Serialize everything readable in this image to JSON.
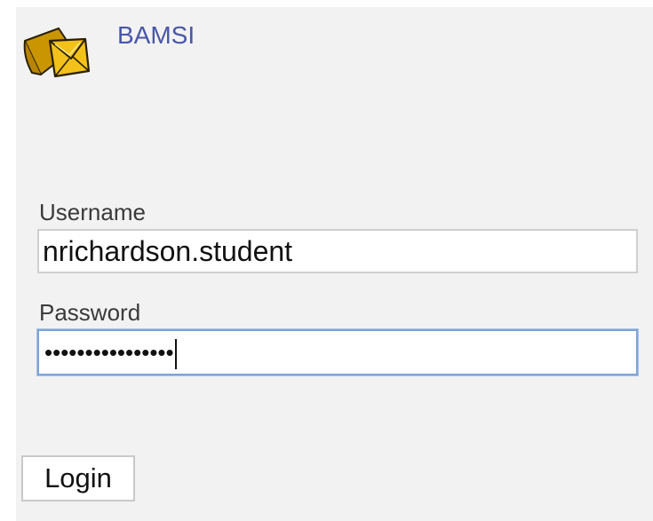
{
  "app": {
    "title": "BAMSI",
    "logo_icon": "gold-mail-logo-icon"
  },
  "login_form": {
    "username_label": "Username",
    "username_value": "nrichardson.student",
    "password_label": "Password",
    "password_masked": "••••••••••••••••",
    "password_focused": true,
    "login_button_label": "Login"
  },
  "colors": {
    "panel_background": "#f2f2f2",
    "title_link": "#4a56a8",
    "focus_border": "#7ea3d8",
    "logo_gold": "#d4a20a"
  }
}
